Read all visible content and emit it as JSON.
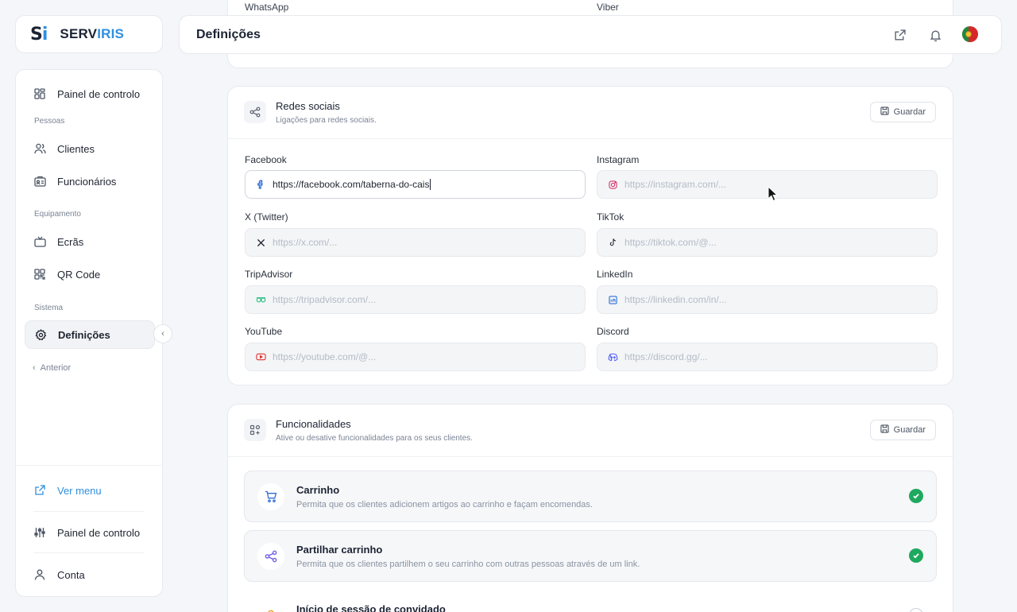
{
  "brand": {
    "logo_s": "S",
    "logo_i": "i",
    "name_serv": "SERV",
    "name_iris": "IRIS"
  },
  "sidebar": {
    "dashboard": "Painel de controlo",
    "section_people": "Pessoas",
    "clients": "Clientes",
    "employees": "Funcionários",
    "section_equipment": "Equipamento",
    "screens": "Ecrãs",
    "qr_code": "QR Code",
    "section_system": "Sistema",
    "settings": "Definições",
    "previous": "Anterior",
    "view_menu": "Ver menu",
    "control_panel": "Painel de controlo",
    "account": "Conta"
  },
  "header": {
    "title": "Definições"
  },
  "top_card": {
    "whatsapp_label": "WhatsApp",
    "viber_label": "Viber"
  },
  "social": {
    "title": "Redes sociais",
    "subtitle": "Ligações para redes sociais.",
    "save": "Guardar",
    "facebook": {
      "label": "Facebook",
      "value": "https://facebook.com/taberna-do-cais"
    },
    "instagram": {
      "label": "Instagram",
      "placeholder": "https://instagram.com/..."
    },
    "twitter": {
      "label": "X (Twitter)",
      "placeholder": "https://x.com/..."
    },
    "tiktok": {
      "label": "TikTok",
      "placeholder": "https://tiktok.com/@..."
    },
    "tripadvisor": {
      "label": "TripAdvisor",
      "placeholder": "https://tripadvisor.com/..."
    },
    "linkedin": {
      "label": "LinkedIn",
      "placeholder": "https://linkedin.com/in/..."
    },
    "youtube": {
      "label": "YouTube",
      "placeholder": "https://youtube.com/@..."
    },
    "discord": {
      "label": "Discord",
      "placeholder": "https://discord.gg/..."
    }
  },
  "features": {
    "title": "Funcionalidades",
    "subtitle": "Ative ou desative funcionalidades para os seus clientes.",
    "save": "Guardar",
    "items": [
      {
        "title": "Carrinho",
        "desc": "Permita que os clientes adicionem artigos ao carrinho e façam encomendas.",
        "enabled": true
      },
      {
        "title": "Partilhar carrinho",
        "desc": "Permita que os clientes partilhem o seu carrinho com outras pessoas através de um link.",
        "enabled": true
      },
      {
        "title": "Início de sessão de convidado",
        "desc": "",
        "enabled": false
      }
    ]
  },
  "colors": {
    "accent": "#2f8fde",
    "success": "#1fa95f"
  }
}
